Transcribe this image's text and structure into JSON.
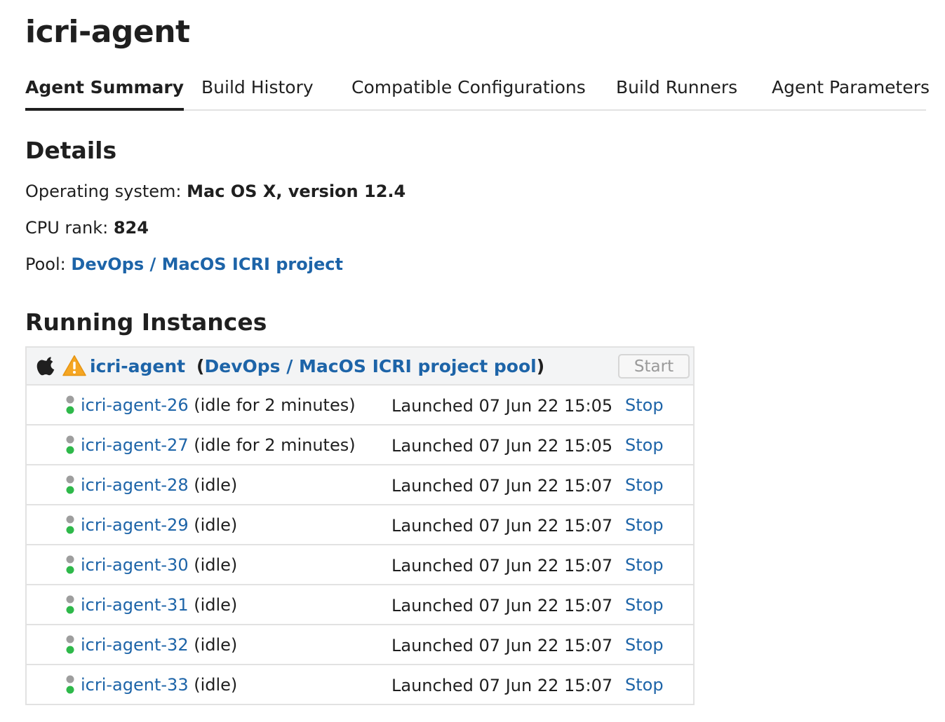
{
  "page": {
    "title": "icri-agent"
  },
  "tabs": [
    {
      "label": "Agent Summary",
      "active": true
    },
    {
      "label": "Build History",
      "active": false
    },
    {
      "label": "Compatible Configurations",
      "active": false
    },
    {
      "label": "Build Runners",
      "active": false
    },
    {
      "label": "Agent Parameters",
      "active": false
    }
  ],
  "details": {
    "title": "Details",
    "os_label": "Operating system:",
    "os_value": "Mac OS X, version 12.4",
    "cpu_label": "CPU rank:",
    "cpu_value": "824",
    "pool_label": "Pool:",
    "pool_value": "DevOps / MacOS ICRI project"
  },
  "running": {
    "title": "Running Instances",
    "header": {
      "icons": [
        "apple-icon",
        "warning-icon"
      ],
      "agent_name": "icri-agent",
      "open_paren": "(",
      "pool_link": "DevOps / MacOS ICRI project pool",
      "close_paren": ")",
      "start_label": "Start"
    },
    "instances": [
      {
        "name": "icri-agent-26",
        "status": "(idle for 2 minutes)",
        "launched": "Launched 07 Jun 22 15:05",
        "stop_label": "Stop"
      },
      {
        "name": "icri-agent-27",
        "status": "(idle for 2 minutes)",
        "launched": "Launched 07 Jun 22 15:05",
        "stop_label": "Stop"
      },
      {
        "name": "icri-agent-28",
        "status": "(idle)",
        "launched": "Launched 07 Jun 22 15:07",
        "stop_label": "Stop"
      },
      {
        "name": "icri-agent-29",
        "status": "(idle)",
        "launched": "Launched 07 Jun 22 15:07",
        "stop_label": "Stop"
      },
      {
        "name": "icri-agent-30",
        "status": "(idle)",
        "launched": "Launched 07 Jun 22 15:07",
        "stop_label": "Stop"
      },
      {
        "name": "icri-agent-31",
        "status": "(idle)",
        "launched": "Launched 07 Jun 22 15:07",
        "stop_label": "Stop"
      },
      {
        "name": "icri-agent-32",
        "status": "(idle)",
        "launched": "Launched 07 Jun 22 15:07",
        "stop_label": "Stop"
      },
      {
        "name": "icri-agent-33",
        "status": "(idle)",
        "launched": "Launched 07 Jun 22 15:07",
        "stop_label": "Stop"
      }
    ]
  },
  "colors": {
    "link": "#1d64a8",
    "status_idle_top": "#9e9e9e",
    "status_connected": "#2eb94a",
    "warning": "#f5a623",
    "border": "#e2e2e2",
    "header_bg": "#f3f4f5"
  }
}
